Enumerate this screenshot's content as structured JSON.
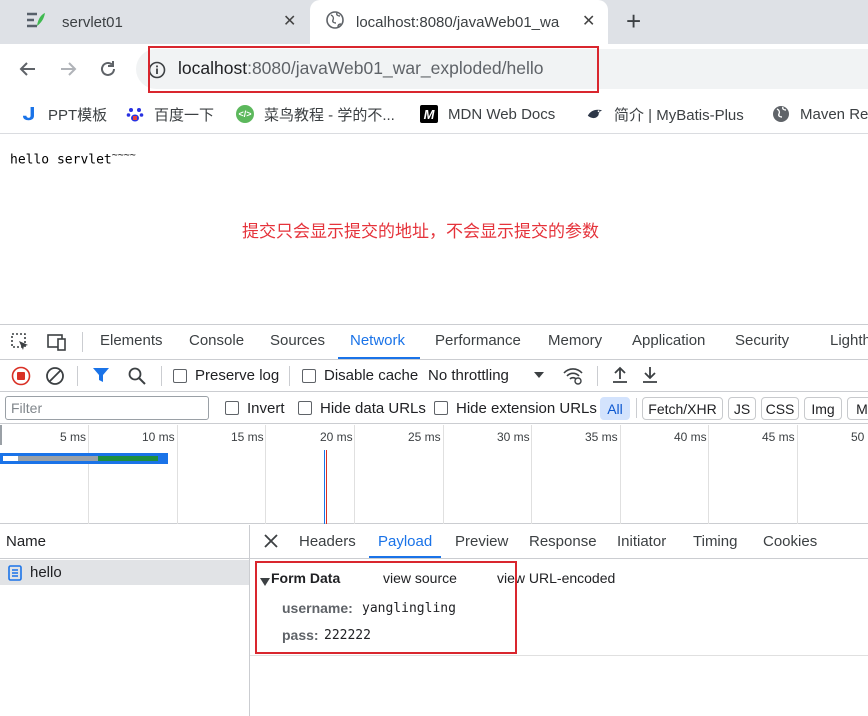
{
  "browser": {
    "tabs": [
      {
        "title": "servlet01",
        "icon": "servlet-icon"
      },
      {
        "title": "localhost:8080/javaWeb01_wa",
        "icon": "globe-icon"
      }
    ],
    "new_tab": "+",
    "url_host": "localhost",
    "url_rest": ":8080/javaWeb01_war_exploded/hello"
  },
  "bookmarks": [
    {
      "label": "PPT模板",
      "icon": "j-icon",
      "color": "#1a73e8"
    },
    {
      "label": "百度一下",
      "icon": "baidu-paw-icon",
      "color": "#2932e1"
    },
    {
      "label": "菜鸟教程 - 学的不...",
      "icon": "runoob-icon",
      "color": "#5cb85c"
    },
    {
      "label": "MDN Web Docs",
      "icon": "mdn-icon",
      "color": "#000000"
    },
    {
      "label": "简介 | MyBatis-Plus",
      "icon": "mybatis-bird-icon",
      "color": "#2d3748"
    },
    {
      "label": "Maven Re",
      "icon": "globe-icon",
      "color": "#5f6368"
    }
  ],
  "page": {
    "hello_text": "hello servlet",
    "hello_suffix": "~~~~",
    "note": "提交只会显示提交的地址，不会显示提交的参数"
  },
  "devtools": {
    "tabs": [
      "Elements",
      "Console",
      "Sources",
      "Network",
      "Performance",
      "Memory",
      "Application",
      "Security",
      "Lighth"
    ],
    "active_tab": "Network",
    "network_toolbar": {
      "preserve_log": "Preserve log",
      "disable_cache": "Disable cache",
      "throttling": "No throttling"
    },
    "filter": {
      "placeholder": "Filter",
      "invert": "Invert",
      "hide_data_urls": "Hide data URLs",
      "hide_extension_urls": "Hide extension URLs",
      "chips": [
        "All",
        "Fetch/XHR",
        "JS",
        "CSS",
        "Img",
        "M"
      ]
    },
    "timeline_ticks": [
      "5 ms",
      "10 ms",
      "15 ms",
      "20 ms",
      "25 ms",
      "30 ms",
      "35 ms",
      "40 ms",
      "45 ms",
      "50"
    ],
    "name_header": "Name",
    "requests": [
      "hello"
    ],
    "detail_tabs": [
      "Headers",
      "Payload",
      "Preview",
      "Response",
      "Initiator",
      "Timing",
      "Cookies"
    ],
    "active_detail_tab": "Payload",
    "form_data": {
      "title": "Form Data",
      "view_source": "view source",
      "view_url_encoded": "view URL-encoded",
      "fields": [
        {
          "key": "username:",
          "value": "yanglingling"
        },
        {
          "key": "pass:",
          "value": "222222"
        }
      ]
    }
  },
  "colors": {
    "accent": "#1a73e8",
    "annotation_red": "#d9262e",
    "record_red": "#d93025"
  }
}
